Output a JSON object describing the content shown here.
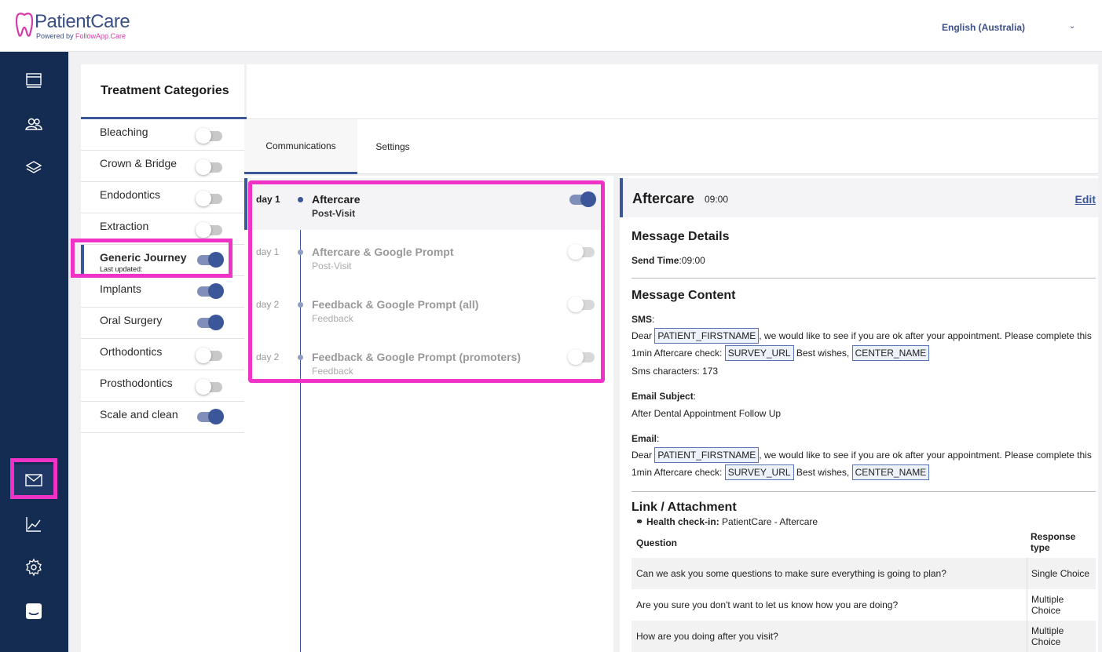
{
  "header": {
    "logo_name": "PatientCare",
    "logo_sub_prefix": "Powered by ",
    "logo_sub_brand": "FollowApp.Care",
    "language": "English (Australia)"
  },
  "nav": {
    "items": [
      "dashboard-icon",
      "patients-icon",
      "layers-icon",
      "mail-icon",
      "chart-icon",
      "settings-icon",
      "chat-icon"
    ]
  },
  "categories": {
    "title": "Treatment Categories",
    "items": [
      {
        "label": "Bleaching",
        "on": false
      },
      {
        "label": "Crown & Bridge",
        "on": false
      },
      {
        "label": "Endodontics",
        "on": false
      },
      {
        "label": "Extraction",
        "on": false
      },
      {
        "label": "Generic Journey",
        "sub": "Last updated:",
        "on": true,
        "active": true
      },
      {
        "label": "Implants",
        "on": true
      },
      {
        "label": "Oral Surgery",
        "on": true
      },
      {
        "label": "Orthodontics",
        "on": false
      },
      {
        "label": "Prosthodontics",
        "on": false
      },
      {
        "label": "Scale and clean",
        "on": true
      }
    ]
  },
  "tabs": {
    "communications": "Communications",
    "settings": "Settings"
  },
  "communications": [
    {
      "day": "day 1",
      "title": "Aftercare",
      "subtitle": "Post-Visit",
      "on": true,
      "selected": true
    },
    {
      "day": "day 1",
      "title": "Aftercare & Google Prompt",
      "subtitle": "Post-Visit",
      "on": false
    },
    {
      "day": "day 2",
      "title": "Feedback & Google Prompt (all)",
      "subtitle": "Feedback",
      "on": false
    },
    {
      "day": "day 2",
      "title": "Feedback & Google Prompt (promoters)",
      "subtitle": "Feedback",
      "on": false
    }
  ],
  "detail": {
    "title": "Aftercare",
    "time": "09:00",
    "edit": "Edit",
    "message_details_heading": "Message Details",
    "send_time_label": "Send Time",
    "send_time_value": ":09:00",
    "message_content_heading": "Message Content",
    "sms_label": "SMS",
    "colon": ":",
    "dear": "Dear",
    "tag_firstname": "PATIENT_FIRSTNAME",
    "msg_part1": ", we would like to see if you are ok after your appointment. Please complete this",
    "msg_part2": "1min Aftercare check:",
    "tag_survey": "SURVEY_URL",
    "msg_part3": "Best wishes,",
    "tag_center": "CENTER_NAME",
    "sms_chars": "Sms characters: 173",
    "email_subject_label": "Email Subject",
    "email_subject_value": "After Dental Appointment Follow Up",
    "email_label": "Email",
    "link_heading": "Link / Attachment",
    "health_checkin_label": "Health check-in:",
    "health_checkin_value": "PatientCare - Aftercare",
    "table": {
      "col_question": "Question",
      "col_response_line1": "Response",
      "col_response_line2": "type",
      "rows": [
        {
          "q": "Can we ask you some questions to make sure everything is going to plan?",
          "r1": "Single Choice",
          "r2": ""
        },
        {
          "q": "Are you sure you don't want to let us know how you are doing?",
          "r1": "Multiple",
          "r2": "Choice"
        },
        {
          "q": "How are you doing after you visit?",
          "r1": "Multiple",
          "r2": "Choice"
        }
      ]
    }
  },
  "colors": {
    "accent": "#3b5699",
    "nav_bg": "#142b52",
    "highlight": "#ee33c6"
  }
}
